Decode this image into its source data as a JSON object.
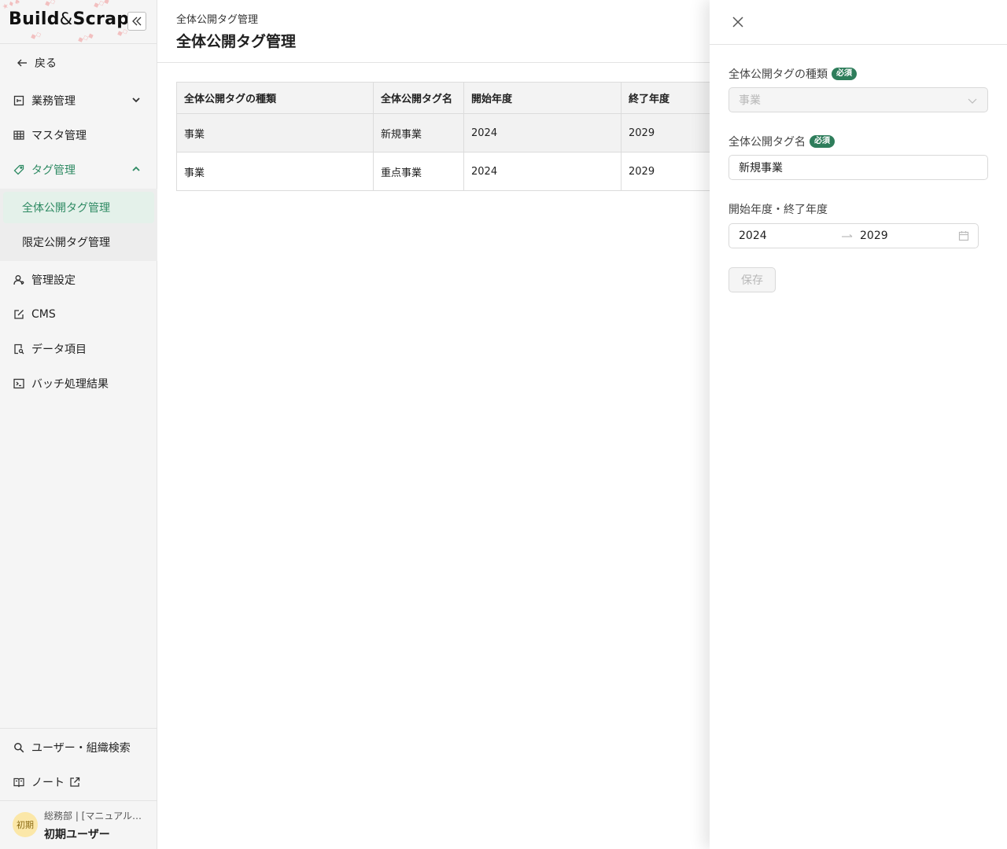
{
  "app": {
    "logo_left": "Build",
    "logo_amp": "&",
    "logo_right": "Scrap"
  },
  "sidebar": {
    "back_label": "戻る",
    "items": [
      {
        "label": "業務管理"
      },
      {
        "label": "マスタ管理"
      },
      {
        "label": "タグ管理"
      },
      {
        "label": "管理設定"
      },
      {
        "label": "CMS"
      },
      {
        "label": "データ項目"
      },
      {
        "label": "バッチ処理結果"
      }
    ],
    "tag_submenu": [
      {
        "label": "全体公開タグ管理"
      },
      {
        "label": "限定公開タグ管理"
      }
    ],
    "bottom": [
      {
        "label": "ユーザー・組織検索"
      },
      {
        "label": "ノート"
      }
    ],
    "user": {
      "avatar_text": "初期",
      "dept": "総務部 | [マニュアル用]",
      "name": "初期ユーザー"
    }
  },
  "header": {
    "breadcrumb": "全体公開タグ管理",
    "title": "全体公開タグ管理"
  },
  "table": {
    "columns": [
      "全体公開タグの種類",
      "全体公開タグ名",
      "開始年度",
      "終了年度"
    ],
    "rows": [
      [
        "事業",
        "新規事業",
        "2024",
        "2029"
      ],
      [
        "事業",
        "重点事業",
        "2024",
        "2029"
      ]
    ]
  },
  "drawer": {
    "type_label": "全体公開タグの種類",
    "type_required": "必須",
    "type_value": "事業",
    "name_label": "全体公開タグ名",
    "name_required": "必須",
    "name_value": "新規事業",
    "period_label": "開始年度・終了年度",
    "start_year": "2024",
    "end_year": "2029",
    "save_label": "保存"
  },
  "colors": {
    "accent": "#2e8a63",
    "badge": "#2e7d5b",
    "sidebar_bg": "#f5f5f5",
    "active_bg": "#e4f1ea"
  }
}
